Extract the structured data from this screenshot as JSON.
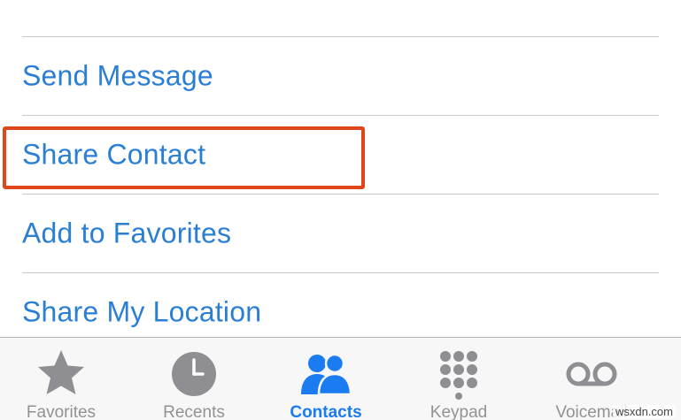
{
  "actions": {
    "send_message": "Send Message",
    "share_contact": "Share Contact",
    "add_to_favorites": "Add to Favorites",
    "share_my_location": "Share My Location"
  },
  "highlight": {
    "target": "share_contact",
    "color": "#e0461a"
  },
  "tabbar": {
    "tabs": [
      {
        "label": "Favorites",
        "icon": "star-icon",
        "active": false
      },
      {
        "label": "Recents",
        "icon": "clock-icon",
        "active": false
      },
      {
        "label": "Contacts",
        "icon": "contacts-icon",
        "active": true
      },
      {
        "label": "Keypad",
        "icon": "keypad-icon",
        "active": false
      },
      {
        "label": "Voicemail",
        "icon": "voicemail-icon",
        "active": false
      }
    ]
  },
  "colors": {
    "action_text": "#2a7fd4",
    "tab_active": "#1a7cf0",
    "tab_inactive": "#929292",
    "divider": "#c8c7cc",
    "tabbar_background": "#f7f7f7"
  },
  "watermark": "wsxdn.com"
}
